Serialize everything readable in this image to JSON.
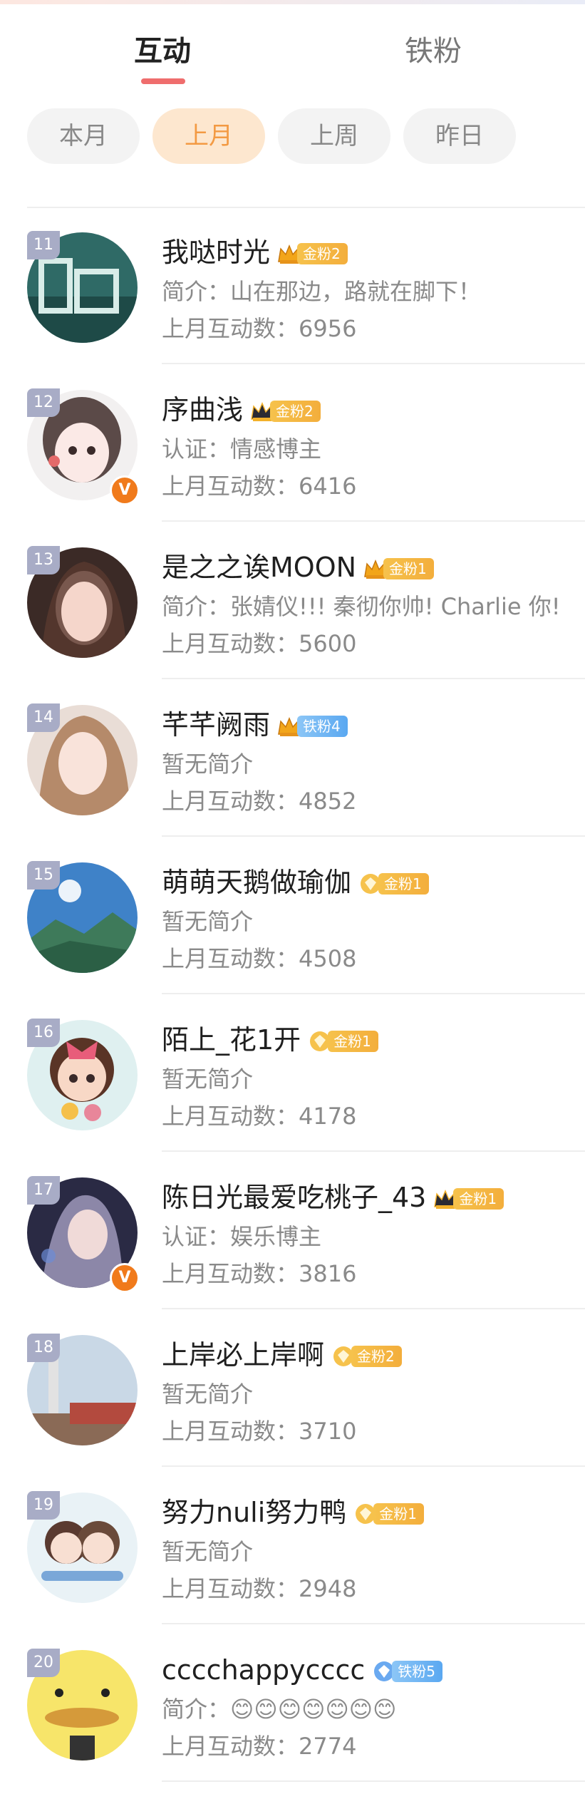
{
  "tabs": [
    "互动",
    "铁粉"
  ],
  "filters": [
    "本月",
    "上月",
    "上周",
    "昨日"
  ],
  "active_filter": "上月",
  "colors": {
    "accent": "#ef6d6d",
    "active_chip_bg": "#fde7cf",
    "active_chip_text": "#f39a43",
    "gold_badge": "#f3ae3c",
    "iron_badge": "#5aa8f1",
    "verified": "#f07a1b"
  },
  "items": [
    {
      "rank": "11",
      "name": "我哒时光",
      "badge_icon": "gold-crown-icon",
      "badge": "金粉2",
      "badge_type": "gold",
      "bio": "简介：山在那边，路就在脚下！",
      "count": "上月互动数：6956",
      "verified": false
    },
    {
      "rank": "12",
      "name": "序曲浅",
      "badge_icon": "black-crown-icon",
      "badge": "金粉2",
      "badge_type": "gold",
      "bio": "认证：情感博主",
      "count": "上月互动数：6416",
      "verified": true
    },
    {
      "rank": "13",
      "name": "是之之诶MOON",
      "badge_icon": "gold-crown-icon",
      "badge": "金粉1",
      "badge_type": "gold",
      "bio": "简介：张婧仪!!!  秦彻你帅! Charlie 你!",
      "count": "上月互动数：5600",
      "verified": false
    },
    {
      "rank": "14",
      "name": "芊芊阙雨",
      "badge_icon": "gold-crown-icon",
      "badge": "铁粉4",
      "badge_type": "iron",
      "bio": "暂无简介",
      "count": "上月互动数：4852",
      "verified": false
    },
    {
      "rank": "15",
      "name": "萌萌天鹅做瑜伽",
      "badge_icon": "gold-gem-icon",
      "badge": "金粉1",
      "badge_type": "gold",
      "bio": "暂无简介",
      "count": "上月互动数：4508",
      "verified": false
    },
    {
      "rank": "16",
      "name": "陌上_花1开",
      "badge_icon": "gold-gem-icon",
      "badge": "金粉1",
      "badge_type": "gold",
      "bio": "暂无简介",
      "count": "上月互动数：4178",
      "verified": false
    },
    {
      "rank": "17",
      "name": "陈日光最爱吃桃子_43",
      "badge_icon": "black-crown-icon",
      "badge": "金粉1",
      "badge_type": "gold",
      "bio": "认证：娱乐博主",
      "count": "上月互动数：3816",
      "verified": true
    },
    {
      "rank": "18",
      "name": "上岸必上岸啊",
      "badge_icon": "gold-gem-icon",
      "badge": "金粉2",
      "badge_type": "gold",
      "bio": "暂无简介",
      "count": "上月互动数：3710",
      "verified": false
    },
    {
      "rank": "19",
      "name": "努力nuli努力鸭",
      "badge_icon": "gold-gem-icon",
      "badge": "金粉1",
      "badge_type": "gold",
      "bio": "暂无简介",
      "count": "上月互动数：2948",
      "verified": false
    },
    {
      "rank": "20",
      "name": "cccchappycccc",
      "badge_icon": "blue-diamond-icon",
      "badge": "铁粉5",
      "badge_type": "iron",
      "bio": "简介：😊😊😊😊😊😊😊",
      "count": "上月互动数：2774",
      "verified": false
    }
  ]
}
